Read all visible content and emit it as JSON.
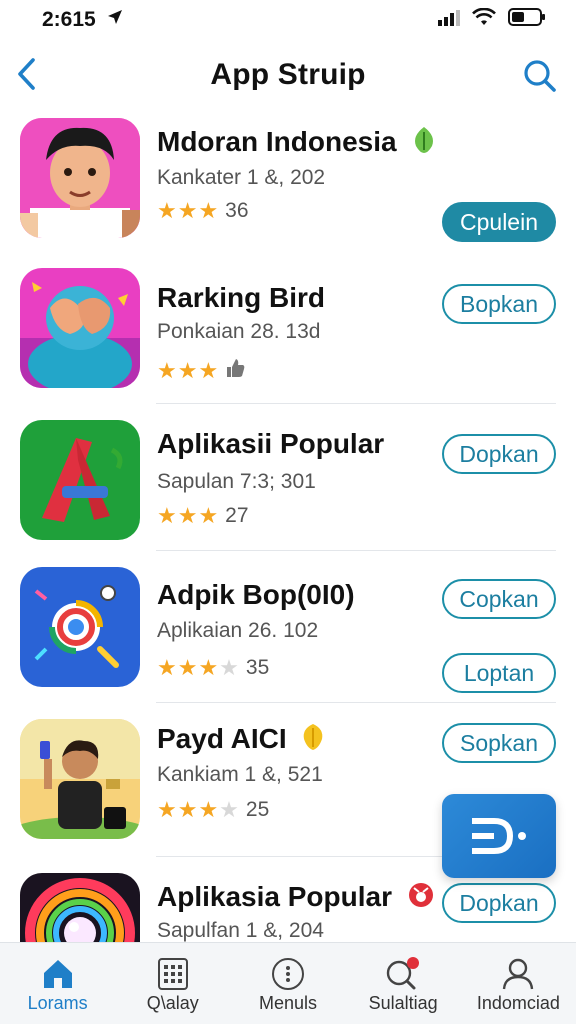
{
  "status": {
    "time": "2:615"
  },
  "header": {
    "title": "App Struip"
  },
  "apps": [
    {
      "name": "Mdoran Indonesia",
      "meta": "Kankater 1 &, 202",
      "stars": 3,
      "rating_text": "36",
      "button": "Cpulein",
      "button_style": "filled"
    },
    {
      "name": "Rarking Bird",
      "meta": "Ponkaian 28. 13d",
      "stars": 3,
      "rating_text": "",
      "button": "Bopkan",
      "button_style": "outline"
    },
    {
      "name": "Aplikasii Popular",
      "meta": "Sapulan 7:3; 301",
      "stars": 3,
      "rating_text": "27",
      "button": "Dopkan",
      "button_style": "outline"
    },
    {
      "name": "Adpik Bop(0I0)",
      "meta": "Aplikaian 26. 102",
      "stars": 3,
      "rating_text": "35",
      "button": "Copkan",
      "button2": "Loptan",
      "button_style": "outline"
    },
    {
      "name": "Payd AICI",
      "meta": "Kankiam 1 &, 521",
      "stars": 3,
      "rating_text": "25",
      "button": "Sopkan",
      "button_style": "outline"
    },
    {
      "name": "Aplikasia Popular",
      "meta": "Sapulfan 1 &, 204",
      "stars": 0,
      "rating_text": "",
      "button": "Dopkan",
      "button_style": "outline"
    }
  ],
  "tabs": [
    {
      "label": "Lorams",
      "icon": "home-icon",
      "active": true
    },
    {
      "label": "Q\\alay",
      "icon": "grid-icon",
      "active": false
    },
    {
      "label": "Menuls",
      "icon": "more-icon",
      "active": false
    },
    {
      "label": "Sulaltiag",
      "icon": "search-icon",
      "active": false
    },
    {
      "label": "Indomciad",
      "icon": "profile-icon",
      "active": false
    }
  ],
  "colors": {
    "accent": "#1f8aa4",
    "tab_active": "#1f7fc8",
    "star": "#f5a623"
  }
}
